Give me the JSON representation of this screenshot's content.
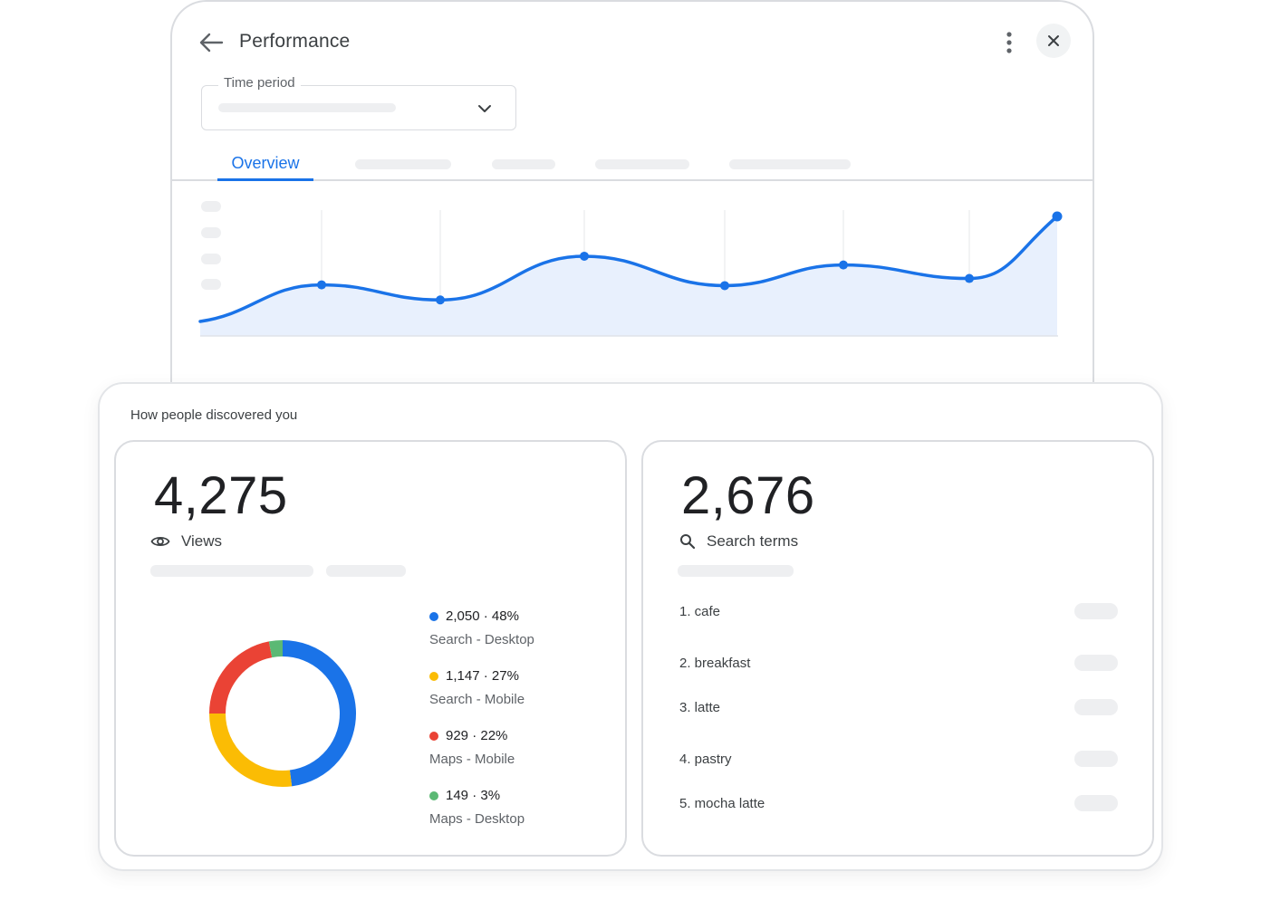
{
  "header": {
    "title": "Performance"
  },
  "time_period": {
    "label": "Time period"
  },
  "tabs": {
    "active_label": "Overview"
  },
  "chart_data": {
    "type": "area",
    "values": [
      0,
      46,
      27,
      82,
      45,
      71,
      54,
      132
    ],
    "color": "#1a73e8",
    "fill": "#e8f0fd",
    "grid": "vertical"
  },
  "discovery": {
    "title": "How people discovered you",
    "views": {
      "value": "4,275",
      "label": "Views",
      "icon": "eye-icon",
      "breakdown": [
        {
          "count": "2,050",
          "percent": "48%",
          "source": "Search - Desktop",
          "color": "#1a73e8",
          "share": 48
        },
        {
          "count": "1,147",
          "percent": "27%",
          "source": "Search - Mobile",
          "color": "#fbbc04",
          "share": 27
        },
        {
          "count": "929",
          "percent": "22%",
          "source": "Maps - Mobile",
          "color": "#ea4335",
          "share": 22
        },
        {
          "count": "149",
          "percent": "3%",
          "source": "Maps - Desktop",
          "color": "#5bb974",
          "share": 3
        }
      ]
    },
    "search_terms": {
      "value": "2,676",
      "label": "Search terms",
      "icon": "search-icon",
      "items": [
        "1. cafe",
        "2. breakfast",
        "3. latte",
        "4. pastry",
        "5. mocha latte"
      ]
    }
  }
}
